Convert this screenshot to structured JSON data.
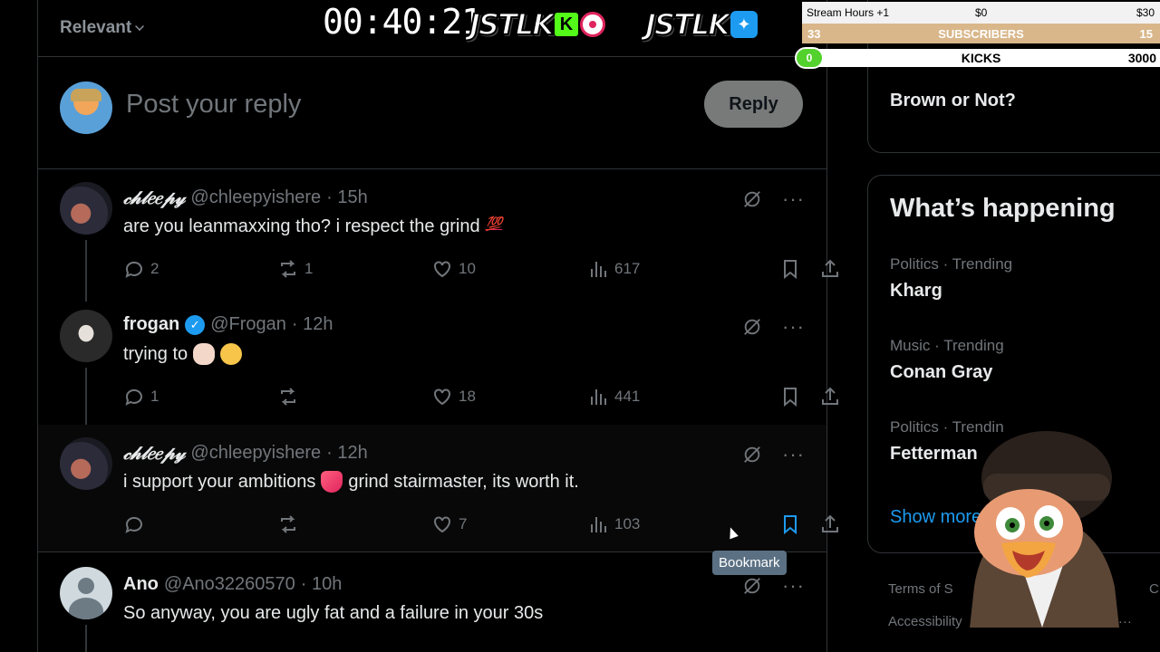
{
  "sort": {
    "label": "Relevant"
  },
  "compose": {
    "placeholder": "Post your reply",
    "reply_label": "Reply"
  },
  "tweets": [
    {
      "name": "𝒸𝒽𝓁𝑒𝑒𝓅𝓎",
      "handle": "@chleepyishere",
      "time": "· 15h",
      "text": "are you leanmaxxing tho? i respect the grind",
      "emoji": "💯",
      "replies": "2",
      "reposts": "1",
      "likes": "10",
      "views": "617"
    },
    {
      "name": "frogan",
      "handle": "@Frogan",
      "time": "· 12h",
      "text": "trying to",
      "replies": "1",
      "reposts": "",
      "likes": "18",
      "views": "441"
    },
    {
      "name": "𝒸𝒽𝓁𝑒𝑒𝓅𝓎",
      "handle": "@chleepyishere",
      "time": "· 12h",
      "text_before": "i support your ambitions",
      "text_after": "grind stairmaster, its worth it.",
      "replies": "",
      "reposts": "",
      "likes": "7",
      "views": "103"
    },
    {
      "name": "Ano",
      "handle": "@Ano32260570",
      "time": "· 10h",
      "text": "So anyway, you are ugly fat and a failure in your 30s"
    }
  ],
  "tooltip": "Bookmark",
  "sidebar": {
    "top_item": "Brown or Not?",
    "whats_happening": "What’s happening",
    "trends": [
      {
        "meta": "Politics · Trending",
        "topic": "Kharg"
      },
      {
        "meta": "Music · Trending",
        "topic": "Conan Gray"
      },
      {
        "meta": "Politics · Trendin",
        "topic": "Fetterman"
      }
    ],
    "show_more": "Show more",
    "footer_terms": "Terms of S",
    "footer_access": "Accessibility",
    "footer_more": "ore ···",
    "footer_c": "C"
  },
  "overlay": {
    "timer": "00:40:21",
    "logo_word": "JSTLK",
    "stream_hours": "Stream Hours +1",
    "money_mid": "$0",
    "money_right": "$30",
    "sub_left": "33",
    "subscribers": "SUBSCRIBERS",
    "sub_right": "15",
    "kicks_count": "0",
    "kicks": "KICKS",
    "kicks_goal": "3000"
  },
  "colors": {
    "accent": "#1d9bf0",
    "muted": "#71767b",
    "border": "#2f3336"
  }
}
